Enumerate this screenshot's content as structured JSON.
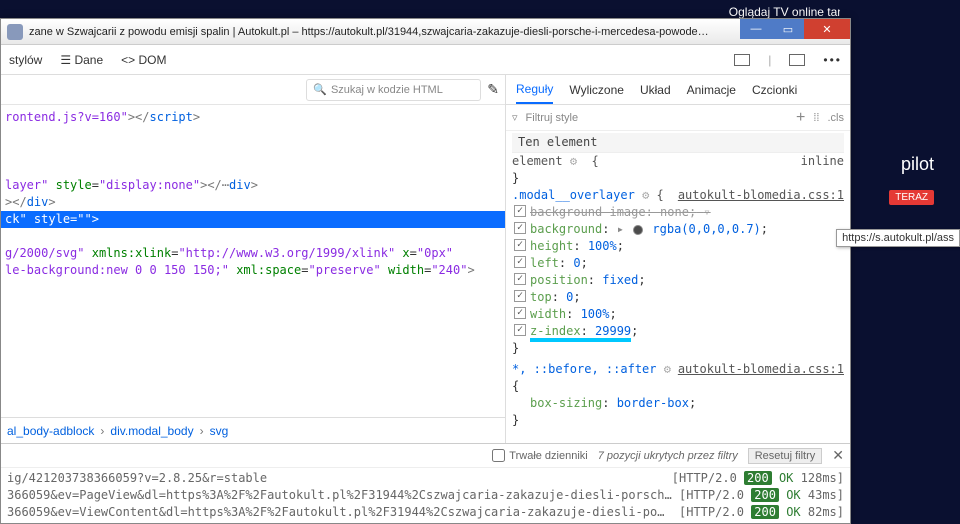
{
  "bg": {
    "promo": "Oglądaj TV online tam, gdzie lubisz!",
    "pilot": "pilot",
    "cta": "TERAZ"
  },
  "win": {
    "title": "zane w Szwajcarii z powodu emisji spalin | Autokult.pl – https://autokult.pl/31944,szwajcaria-zakazuje-diesli-porsche-i-mercedesa-powode…"
  },
  "toolbar": {
    "stylow": "stylów",
    "dane": "Dane",
    "dom": "DOM"
  },
  "search": {
    "placeholder": "Szukaj w kodzie HTML"
  },
  "code": {
    "l1a": "rontend.js?v=160\"",
    "l1b": "></",
    "l1c": "script",
    "l1d": ">",
    "l2a": "layer\"",
    "l2b": "style",
    "l2c": "=",
    "l2d": "\"display:none\"",
    "l2e": "></",
    "l2f": "div",
    "l2g": ">",
    "l3a": "></",
    "l3b": "div",
    "l3c": ">",
    "l4a": "ck\"",
    "l4b": "style",
    "l4c": "=\"\"",
    "l4d": ">",
    "l5a": "g/2000/svg\"",
    "l5b": "xmlns:xlink",
    "l5c": "=",
    "l5d": "\"http://www.w3.org/1999/xlink\"",
    "l5e": "x",
    "l5f": "=",
    "l5g": "\"0px\"",
    "l6a": "le-background:new 0 0 150 150;\"",
    "l6b": "xml:space",
    "l6c": "=",
    "l6d": "\"preserve\"",
    "l6e": "width",
    "l6f": "=",
    "l6g": "\"240\"",
    "l6h": ">"
  },
  "crumbs": {
    "a": "al_body-adblock",
    "b": "div.modal_body",
    "c": "svg"
  },
  "tabs": {
    "reg": "Reguły",
    "wyl": "Wyliczone",
    "uk": "Układ",
    "an": "Animacje",
    "cz": "Czcionki"
  },
  "filter": {
    "ph": "Filtruj style",
    "cls": ".cls"
  },
  "rules": {
    "sec1": "Ten element",
    "sel1": "element",
    "inline": "inline",
    "sel2": ".modal__overlayer",
    "src2": "autokult-blomedia.css:1",
    "p1n": "background-image",
    "p1v": "none",
    "p2n": "background",
    "p2v": "rgba(0,0,0,0.7)",
    "p3n": "height",
    "p3v": "100%",
    "p4n": "left",
    "p4v": "0",
    "p5n": "position",
    "p5v": "fixed",
    "p6n": "top",
    "p6v": "0",
    "p7n": "width",
    "p7v": "100%",
    "p8n": "z-index",
    "p8v": "29999",
    "sel3": "*, ::before, ::after",
    "src3": "autokult-blomedia.css:1",
    "p9n": "box-sizing",
    "p9v": "border-box"
  },
  "console": {
    "chk": "Trwałe dzienniki",
    "hidden": "7 pozycji ukrytych przez filtry",
    "reset": "Resetuj filtry",
    "l1r": "ig/421203738366059?v=2.8.25&r=stable",
    "l1s": "[HTTP/2.0",
    "l1c": "200",
    "l1o": "OK",
    "l1t": "128ms]",
    "l2r": "366059&ev=PageView&dl=https%3A%2F%2Fautokult.pl%2F31944%2Cszwajcaria-zakazuje-diesli-porsch…",
    "l2s": "[HTTP/2.0",
    "l2c": "200",
    "l2o": "OK",
    "l2t": "43ms]",
    "l3r": "366059&ev=ViewContent&dl=https%3A%2F%2Fautokult.pl%2F31944%2Cszwajcaria-zakazuje-diesli-po…",
    "l3s": "[HTTP/2.0",
    "l3c": "200",
    "l3o": "OK",
    "l3t": "82ms]"
  },
  "tooltip": "https://s.autokult.pl/ass"
}
